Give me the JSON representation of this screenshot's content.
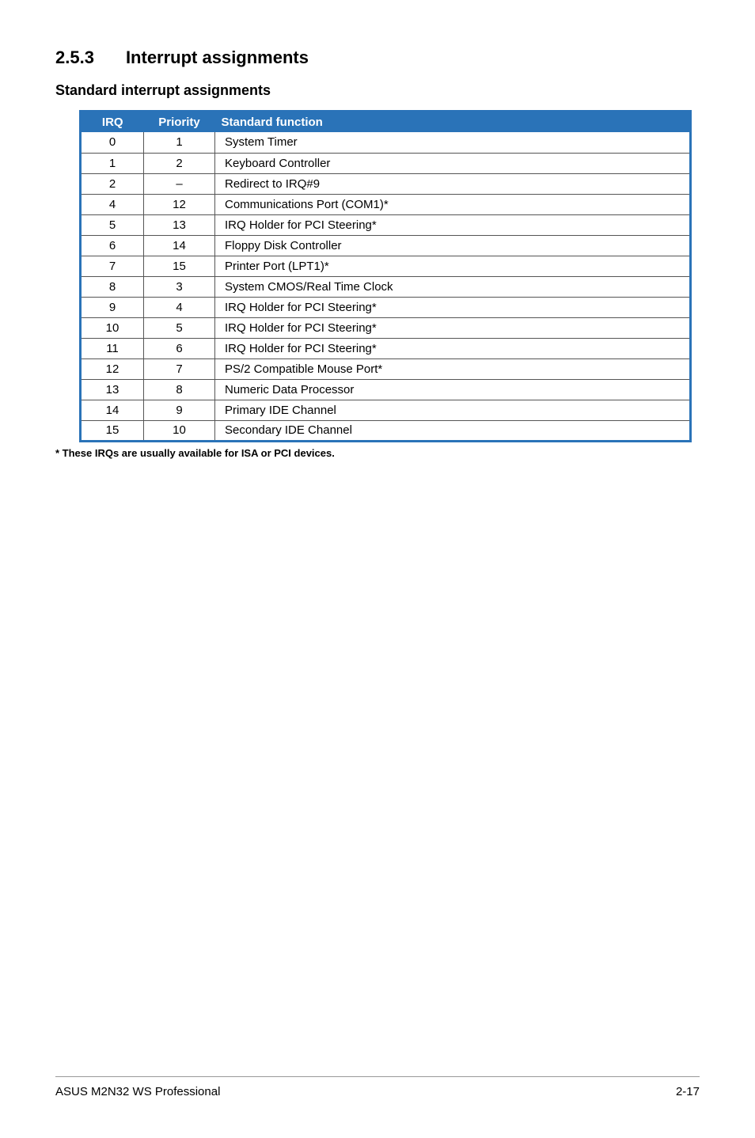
{
  "section": {
    "number": "2.5.3",
    "title": "Interrupt assignments"
  },
  "subheading": "Standard interrupt assignments",
  "table": {
    "headers": {
      "irq": "IRQ",
      "priority": "Priority",
      "func": "Standard function"
    },
    "rows": [
      {
        "irq": "0",
        "priority": "1",
        "func": "System Timer"
      },
      {
        "irq": "1",
        "priority": "2",
        "func": "Keyboard Controller"
      },
      {
        "irq": "2",
        "priority": "–",
        "func": "Redirect to IRQ#9"
      },
      {
        "irq": "4",
        "priority": "12",
        "func": "Communications Port (COM1)*"
      },
      {
        "irq": "5",
        "priority": "13",
        "func": "IRQ Holder for PCI Steering*"
      },
      {
        "irq": "6",
        "priority": "14",
        "func": "Floppy Disk Controller"
      },
      {
        "irq": "7",
        "priority": "15",
        "func": "Printer Port (LPT1)*"
      },
      {
        "irq": "8",
        "priority": "3",
        "func": "System CMOS/Real Time Clock"
      },
      {
        "irq": "9",
        "priority": "4",
        "func": "IRQ Holder for PCI Steering*"
      },
      {
        "irq": "10",
        "priority": "5",
        "func": "IRQ Holder for PCI Steering*"
      },
      {
        "irq": "11",
        "priority": "6",
        "func": "IRQ Holder for PCI Steering*"
      },
      {
        "irq": "12",
        "priority": "7",
        "func": "PS/2 Compatible Mouse Port*"
      },
      {
        "irq": "13",
        "priority": "8",
        "func": "Numeric Data Processor"
      },
      {
        "irq": "14",
        "priority": "9",
        "func": "Primary IDE Channel"
      },
      {
        "irq": "15",
        "priority": "10",
        "func": "Secondary IDE Channel"
      }
    ]
  },
  "footnote": "* These IRQs are usually available for ISA or PCI devices.",
  "footer": {
    "left": "ASUS M2N32 WS Professional",
    "right": "2-17"
  }
}
